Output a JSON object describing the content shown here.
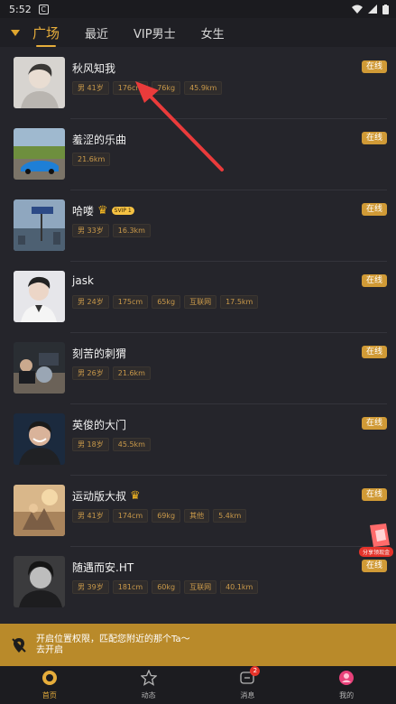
{
  "status_bar": {
    "time": "5:52",
    "app_icon_letter": "C"
  },
  "top_tabs": {
    "items": [
      {
        "label": "广场",
        "active": true
      },
      {
        "label": "最近",
        "active": false
      },
      {
        "label": "VIP男士",
        "active": false
      },
      {
        "label": "女生",
        "active": false
      }
    ]
  },
  "users": [
    {
      "name": "秋风知我",
      "tags": [
        "男 41岁",
        "176cm",
        "76kg",
        "45.9km"
      ],
      "status": "在线",
      "crown": false,
      "vip": ""
    },
    {
      "name": "羞涩的乐曲",
      "tags": [
        "21.6km"
      ],
      "status": "在线",
      "crown": false,
      "vip": ""
    },
    {
      "name": "哈喽",
      "tags": [
        "男 33岁",
        "16.3km"
      ],
      "status": "在线",
      "crown": true,
      "vip": "SVIP 1"
    },
    {
      "name": "jask",
      "tags": [
        "男 24岁",
        "175cm",
        "65kg",
        "互联网",
        "17.5km"
      ],
      "status": "在线",
      "crown": false,
      "vip": ""
    },
    {
      "name": "刻苦的刺猬",
      "tags": [
        "男 26岁",
        "21.6km"
      ],
      "status": "在线",
      "crown": false,
      "vip": ""
    },
    {
      "name": "英俊的大门",
      "tags": [
        "男 18岁",
        "45.5km"
      ],
      "status": "在线",
      "crown": false,
      "vip": ""
    },
    {
      "name": "运动版大叔",
      "tags": [
        "男 41岁",
        "174cm",
        "69kg",
        "其他",
        "5.4km"
      ],
      "status": "在线",
      "crown": true,
      "vip": ""
    },
    {
      "name": "随遇而安.HT",
      "tags": [
        "男 39岁",
        "181cm",
        "60kg",
        "互联网",
        "40.1km"
      ],
      "status": "在线",
      "crown": false,
      "vip": ""
    }
  ],
  "share_badge": {
    "label": "分享领现金"
  },
  "location_bar": {
    "line1": "开启位置权限，匹配您附近的那个Ta～",
    "line2": "去开启"
  },
  "bottom_nav": {
    "items": [
      {
        "label": "首页",
        "icon": "home-icon",
        "active": true,
        "badge": ""
      },
      {
        "label": "动态",
        "icon": "star-icon",
        "active": false,
        "badge": ""
      },
      {
        "label": "消息",
        "icon": "message-icon",
        "active": false,
        "badge": "2"
      },
      {
        "label": "我的",
        "icon": "profile-icon",
        "active": false,
        "badge": ""
      }
    ]
  },
  "colors": {
    "accent": "#e6ad3b",
    "online_badge": "#d09a36",
    "location_bar": "#b98a2a",
    "annotation_arrow": "#ea3b3b"
  }
}
